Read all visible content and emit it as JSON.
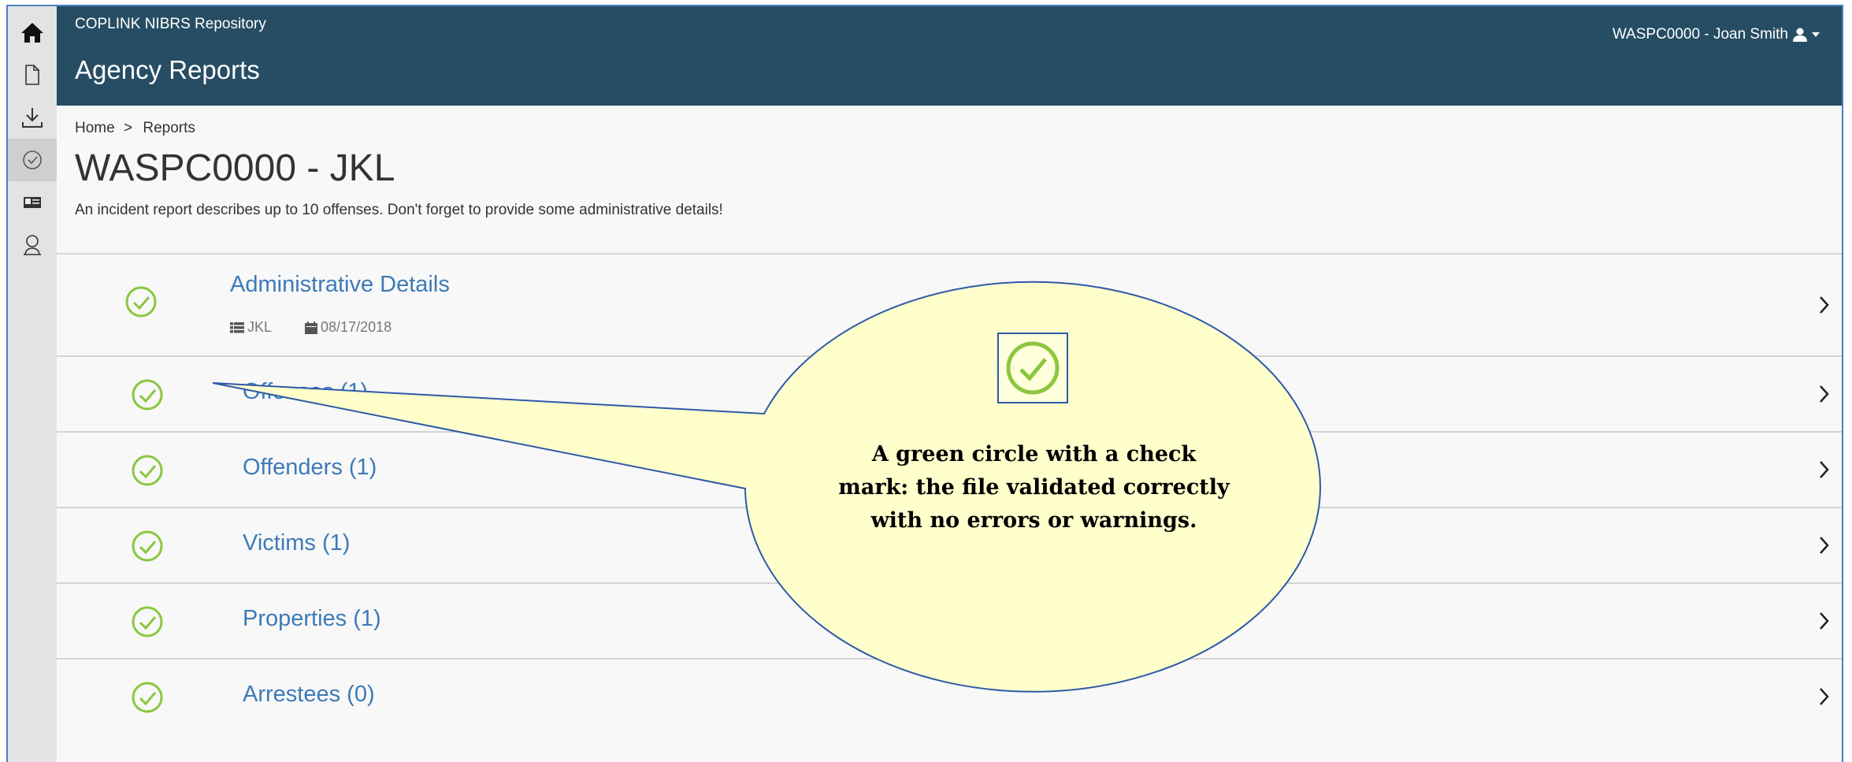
{
  "app": {
    "name": "COPLINK NIBRS Repository",
    "page_heading": "Agency Reports",
    "user_label": "WASPC0000 - Joan Smith"
  },
  "sidebar": {
    "items": [
      {
        "icon": "home-icon",
        "active": false
      },
      {
        "icon": "document-icon",
        "active": false
      },
      {
        "icon": "download-icon",
        "active": false
      },
      {
        "icon": "check-circle-icon",
        "active": true
      },
      {
        "icon": "id-card-icon",
        "active": false
      },
      {
        "icon": "user-icon",
        "active": false
      }
    ]
  },
  "breadcrumb": {
    "home": "Home",
    "separator": ">",
    "current": "Reports"
  },
  "report": {
    "title": "WASPC0000 - JKL",
    "description": "An incident report describes up to 10 offenses. Don't forget to provide some administrative details!"
  },
  "sections": [
    {
      "label": "Administrative Details",
      "status": "valid",
      "meta": {
        "agency": "JKL",
        "date": "08/17/2018"
      }
    },
    {
      "label": "Offenses (1)",
      "status": "valid"
    },
    {
      "label": "Offenders (1)",
      "status": "valid"
    },
    {
      "label": "Victims (1)",
      "status": "valid"
    },
    {
      "label": "Properties (1)",
      "status": "valid"
    },
    {
      "label": "Arrestees (0)",
      "status": "valid"
    }
  ],
  "callout": {
    "text_lines": [
      "A green circle with a check",
      "mark: the file validated correctly",
      "with no errors or warnings."
    ]
  },
  "colors": {
    "header_bg": "#264d63",
    "link": "#3d7ab8",
    "valid_green": "#8cc63f",
    "callout_fill": "#ffffcc",
    "callout_border": "#2f5aa8"
  }
}
